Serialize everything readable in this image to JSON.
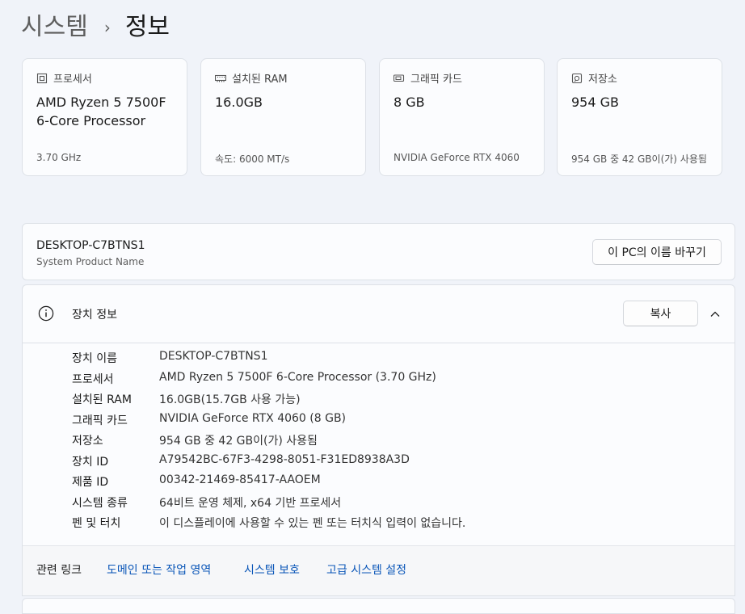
{
  "breadcrumb": {
    "parent": "시스템",
    "separator": "›",
    "current": "정보"
  },
  "cards": [
    {
      "icon": "processor-icon",
      "title": "프로세서",
      "value": "AMD Ryzen 5 7500F 6-Core Processor",
      "sub": "3.70 GHz"
    },
    {
      "icon": "ram-icon",
      "title": "설치된 RAM",
      "value": "16.0GB",
      "sub": "속도: 6000 MT/s"
    },
    {
      "icon": "graphics-card-icon",
      "title": "그래픽 카드",
      "value": "8 GB",
      "sub": "NVIDIA GeForce RTX 4060"
    },
    {
      "icon": "storage-icon",
      "title": "저장소",
      "value": "954 GB",
      "sub": "954 GB 중 42 GB이(가) 사용됨"
    }
  ],
  "pc": {
    "name": "DESKTOP-C7BTNS1",
    "model": "System Product Name",
    "rename_label": "이 PC의 이름 바꾸기"
  },
  "device_info": {
    "title": "장치 정보",
    "copy_label": "복사",
    "rows": [
      {
        "label": "장치 이름",
        "value": "DESKTOP-C7BTNS1"
      },
      {
        "label": "프로세서",
        "value": "AMD Ryzen 5 7500F 6-Core Processor (3.70 GHz)"
      },
      {
        "label": "설치된 RAM",
        "value": "16.0GB(15.7GB 사용 가능)"
      },
      {
        "label": "그래픽 카드",
        "value": "NVIDIA GeForce RTX 4060 (8 GB)"
      },
      {
        "label": "저장소",
        "value": "954 GB 중 42 GB이(가) 사용됨"
      },
      {
        "label": "장치 ID",
        "value": "A79542BC-67F3-4298-8051-F31ED8938A3D"
      },
      {
        "label": "제품 ID",
        "value": "00342-21469-85417-AAOEM"
      },
      {
        "label": "시스템 종류",
        "value": "64비트 운영 체제, x64 기반 프로세서"
      },
      {
        "label": "펜 및 터치",
        "value": "이 디스플레이에 사용할 수 있는 펜 또는 터치식 입력이 없습니다."
      }
    ]
  },
  "related": {
    "label": "관련 링크",
    "links": [
      "도메인 또는 작업 영역",
      "시스템 보호",
      "고급 시스템 설정"
    ]
  },
  "colors": {
    "background": "#f0f3f9",
    "card": "#fbfcfe",
    "link": "#0a56b8"
  }
}
